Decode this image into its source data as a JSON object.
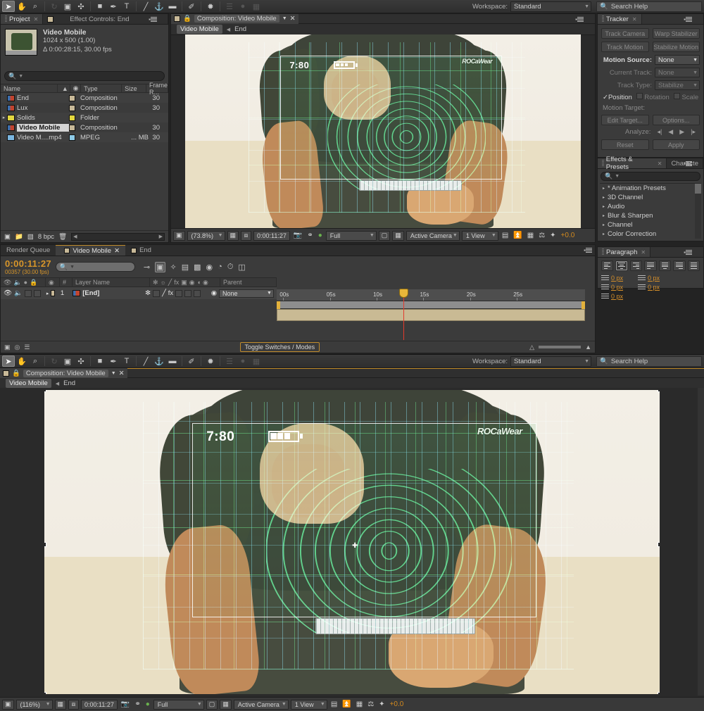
{
  "app": {
    "title": "Adobe After Effects"
  },
  "toolbar": {
    "tools": [
      {
        "name": "selection-tool",
        "glyph": "➤",
        "active": true
      },
      {
        "name": "hand-tool",
        "glyph": "✋",
        "active": false
      },
      {
        "name": "zoom-tool",
        "glyph": "⌕",
        "active": false
      },
      {
        "name": "rotation-tool",
        "glyph": "↻",
        "active": false
      },
      {
        "name": "camera-tool",
        "glyph": "🎥",
        "active": false
      },
      {
        "name": "pan-behind-tool",
        "glyph": "✣",
        "active": false
      },
      {
        "name": "shape-tool",
        "glyph": "■",
        "active": false
      },
      {
        "name": "pen-tool",
        "glyph": "✒",
        "active": false
      },
      {
        "name": "text-tool",
        "glyph": "T",
        "active": false
      },
      {
        "name": "brush-tool",
        "glyph": "╱",
        "active": false
      },
      {
        "name": "clone-stamp-tool",
        "glyph": "⚓",
        "active": false
      },
      {
        "name": "eraser-tool",
        "glyph": "▰",
        "active": false
      },
      {
        "name": "roto-brush-tool",
        "glyph": "✐",
        "active": false
      },
      {
        "name": "puppet-tool",
        "glyph": "✹",
        "active": false
      }
    ],
    "workspace_label": "Workspace:",
    "workspace_value": "Standard",
    "search_placeholder": "Search Help"
  },
  "project": {
    "tab_label": "Project",
    "effect_controls_tab": "Effect Controls: End",
    "item_name": "Video Mobile",
    "item_res": "1024 x 500 (1.00)",
    "item_duration": "Δ 0:00:28:15, 30.00 fps",
    "search_placeholder": "",
    "columns": [
      "Name",
      "Type",
      "Size",
      "Frame R..."
    ],
    "rows": [
      {
        "name": "End",
        "type": "Composition",
        "size": "",
        "framerate": "30",
        "icon": "comp",
        "swatch": "beige",
        "selected": false,
        "folder": false
      },
      {
        "name": "Lux",
        "type": "Composition",
        "size": "",
        "framerate": "30",
        "icon": "comp",
        "swatch": "beige",
        "selected": false,
        "folder": false
      },
      {
        "name": "Solids",
        "type": "Folder",
        "size": "",
        "framerate": "",
        "icon": "folder",
        "swatch": "yellow",
        "selected": false,
        "folder": true
      },
      {
        "name": "Video Mobile",
        "type": "Composition",
        "size": "",
        "framerate": "30",
        "icon": "comp",
        "swatch": "beige",
        "selected": true,
        "folder": false
      },
      {
        "name": "Video M....mp4",
        "type": "MPEG",
        "size": "... MB",
        "framerate": "30",
        "icon": "mpeg",
        "swatch": "blue",
        "selected": false,
        "folder": false
      }
    ],
    "bit_depth": "8 bpc"
  },
  "comp_viewer": {
    "tab_label": "Composition: Video Mobile",
    "breadcrumb_current": "Video Mobile",
    "breadcrumb_next": "End",
    "footer": {
      "zoom": "(73.8%)",
      "timecode": "0:00:11:27",
      "resolution": "Full",
      "camera": "Active Camera",
      "views": "1 View",
      "exposure": "+0.0"
    }
  },
  "comp_viewer_bottom": {
    "tab_label": "Composition: Video Mobile",
    "breadcrumb_current": "Video Mobile",
    "breadcrumb_next": "End",
    "footer": {
      "zoom": "(116%)",
      "timecode": "0:00:11:27",
      "resolution": "Full",
      "camera": "Active Camera",
      "views": "1 View",
      "exposure": "+0.0"
    }
  },
  "video": {
    "hud_time": "7:80",
    "hud_brand": "ROCaWear",
    "battery_bars_filled": 3,
    "battery_bars_total": 4
  },
  "tracker": {
    "tab_label": "Tracker",
    "buttons": [
      "Track Camera",
      "Warp Stabilizer",
      "Track Motion",
      "Stabilize Motion"
    ],
    "fields": [
      {
        "label": "Motion Source:",
        "value": "None",
        "enabled": true
      },
      {
        "label": "Current Track:",
        "value": "None",
        "enabled": false
      },
      {
        "label": "Track Type:",
        "value": "Stabilize",
        "enabled": false
      }
    ],
    "checks": [
      {
        "label": "Position",
        "checked": true
      },
      {
        "label": "Rotation",
        "checked": false
      },
      {
        "label": "Scale",
        "checked": false
      }
    ],
    "motion_target_label": "Motion Target:",
    "edit_target": "Edit Target...",
    "options": "Options...",
    "analyze_label": "Analyze:",
    "reset": "Reset",
    "apply": "Apply"
  },
  "effects": {
    "tab_label": "Effects & Presets",
    "tab2_label": "Characte",
    "search_placeholder": "",
    "items": [
      "* Animation Presets",
      "3D Channel",
      "Audio",
      "Blur & Sharpen",
      "Channel",
      "Color Correction"
    ]
  },
  "paragraph": {
    "tab_label": "Paragraph",
    "values": [
      "0 px",
      "0 px",
      "0 px",
      "0 px",
      "0 px"
    ],
    "unit": "px"
  },
  "timeline": {
    "tabs": [
      {
        "label": "Render Queue",
        "selected": false,
        "has_icon": false
      },
      {
        "label": "Video Mobile",
        "selected": true,
        "has_icon": true
      },
      {
        "label": "End",
        "selected": false,
        "has_icon": true
      }
    ],
    "current_time": "0:00:11:27",
    "frame_info": "00357 (30.00 fps)",
    "search_placeholder": "",
    "columns": [
      "#",
      "Layer Name",
      "Parent"
    ],
    "layers": [
      {
        "index": "1",
        "name": "[End]",
        "parent": "None"
      }
    ],
    "ruler_ticks": [
      "00s",
      "05s",
      "10s",
      "15s",
      "20s",
      "25s"
    ],
    "toggle_switches": "Toggle Switches / Modes"
  }
}
